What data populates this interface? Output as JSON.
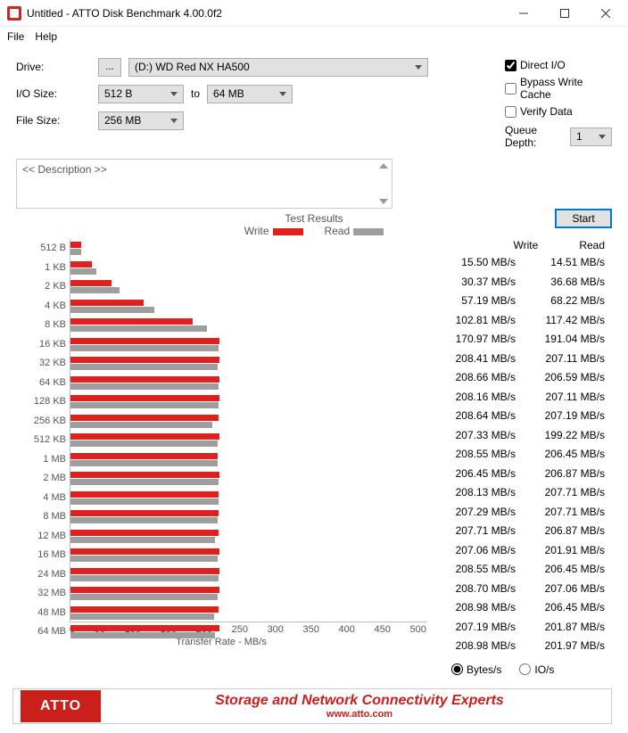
{
  "window": {
    "title": "Untitled - ATTO Disk Benchmark 4.00.0f2"
  },
  "menu": {
    "file": "File",
    "help": "Help"
  },
  "labels": {
    "drive": "Drive:",
    "iosize": "I/O Size:",
    "to": "to",
    "filesize": "File Size:",
    "direct_io": "Direct I/O",
    "bypass": "Bypass Write Cache",
    "verify": "Verify Data",
    "queue_depth": "Queue Depth:",
    "start": "Start",
    "desc_ph": "<< Description >>",
    "browse": "...",
    "test_results": "Test Results",
    "write": "Write",
    "read": "Read",
    "xlabel": "Transfer Rate - MB/s",
    "bytes": "Bytes/s",
    "ios": "IO/s"
  },
  "values": {
    "drive": "(D:) WD Red NX HA500",
    "io_from": "512 B",
    "io_to": "64 MB",
    "filesize": "256 MB",
    "queue_depth": "1"
  },
  "banner": {
    "badge": "ATTO",
    "line1": "Storage and Network Connectivity Experts",
    "line2": "www.atto.com"
  },
  "watermark": "",
  "chart_data": {
    "type": "bar",
    "orientation": "horizontal",
    "title": "Test Results",
    "xlabel": "Transfer Rate - MB/s",
    "ylabel": "",
    "xlim": [
      0,
      500
    ],
    "xticks": [
      0,
      50,
      100,
      150,
      200,
      250,
      300,
      350,
      400,
      450,
      500
    ],
    "categories": [
      "512 B",
      "1 KB",
      "2 KB",
      "4 KB",
      "8 KB",
      "16 KB",
      "32 KB",
      "64 KB",
      "128 KB",
      "256 KB",
      "512 KB",
      "1 MB",
      "2 MB",
      "4 MB",
      "8 MB",
      "12 MB",
      "16 MB",
      "24 MB",
      "32 MB",
      "48 MB",
      "64 MB"
    ],
    "series": [
      {
        "name": "Write",
        "color": "#e01f1f",
        "values": [
          15.5,
          30.37,
          57.19,
          102.81,
          170.97,
          208.41,
          208.66,
          208.16,
          208.64,
          207.33,
          208.55,
          206.45,
          208.13,
          207.29,
          207.71,
          207.06,
          208.55,
          208.7,
          208.98,
          207.19,
          208.98
        ],
        "display": [
          "15.50 MB/s",
          "30.37 MB/s",
          "57.19 MB/s",
          "102.81 MB/s",
          "170.97 MB/s",
          "208.41 MB/s",
          "208.66 MB/s",
          "208.16 MB/s",
          "208.64 MB/s",
          "207.33 MB/s",
          "208.55 MB/s",
          "206.45 MB/s",
          "208.13 MB/s",
          "207.29 MB/s",
          "207.71 MB/s",
          "207.06 MB/s",
          "208.55 MB/s",
          "208.70 MB/s",
          "208.98 MB/s",
          "207.19 MB/s",
          "208.98 MB/s"
        ]
      },
      {
        "name": "Read",
        "color": "#9e9e9e",
        "values": [
          14.51,
          36.68,
          68.22,
          117.42,
          191.04,
          207.11,
          206.59,
          207.11,
          207.19,
          199.22,
          206.45,
          206.87,
          207.71,
          207.71,
          206.87,
          201.91,
          206.45,
          207.06,
          206.45,
          201.87,
          201.97
        ],
        "display": [
          "14.51 MB/s",
          "36.68 MB/s",
          "68.22 MB/s",
          "117.42 MB/s",
          "191.04 MB/s",
          "207.11 MB/s",
          "206.59 MB/s",
          "207.11 MB/s",
          "207.19 MB/s",
          "199.22 MB/s",
          "206.45 MB/s",
          "206.87 MB/s",
          "207.71 MB/s",
          "207.71 MB/s",
          "206.87 MB/s",
          "201.91 MB/s",
          "206.45 MB/s",
          "207.06 MB/s",
          "206.45 MB/s",
          "201.87 MB/s",
          "201.97 MB/s"
        ]
      }
    ]
  }
}
